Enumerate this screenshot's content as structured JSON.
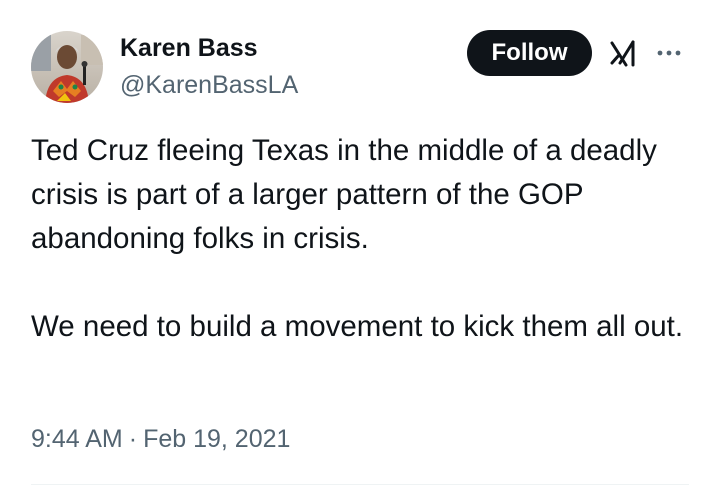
{
  "author": {
    "display_name": "Karen Bass",
    "handle": "@KarenBassLA"
  },
  "actions": {
    "follow_label": "Follow",
    "grok_icon": "grok-icon",
    "more_icon": "more-options-icon"
  },
  "tweet": {
    "paragraphs": [
      "Ted Cruz fleeing Texas in the middle of a deadly crisis is part of a larger pattern of the GOP abandoning folks in crisis.",
      "We need to build a movement to kick them all out."
    ],
    "time": "9:44 AM",
    "separator": "·",
    "date": "Feb 19, 2021"
  },
  "colors": {
    "text": "#0f1419",
    "secondary": "#536471",
    "follow_bg": "#0f1419",
    "follow_text": "#ffffff"
  }
}
